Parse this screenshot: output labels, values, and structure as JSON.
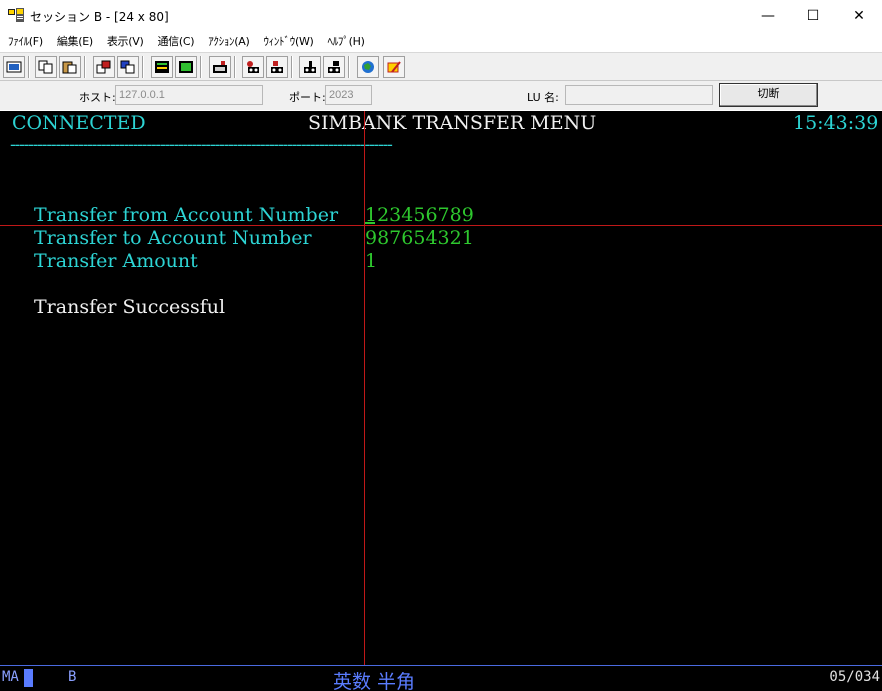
{
  "window": {
    "title": "セッション B - [24 x 80]",
    "controls": {
      "minimize": "—",
      "maximize": "☐",
      "close": "✕"
    }
  },
  "menu": [
    {
      "label": "ﾌｧｲﾙ(F)"
    },
    {
      "label": "編集(E)"
    },
    {
      "label": "表示(V)"
    },
    {
      "label": "通信(C)"
    },
    {
      "label": "ｱｸｼｮﾝ(A)"
    },
    {
      "label": "ｳｨﾝﾄﾞｳ(W)"
    },
    {
      "label": "ﾍﾙﾌﾟ(H)"
    }
  ],
  "toolbar": {
    "icons": [
      "print-screen-icon",
      "copy-icon",
      "paste-icon",
      "send-file-icon",
      "receive-file-icon",
      "display-setup-icon",
      "keyboard-setup-icon",
      "macro-record-icon",
      "macro-play-icon",
      "macro-stop-icon",
      "clipboard-icon",
      "screen-capture-icon",
      "globe-icon",
      "edit-icon"
    ]
  },
  "connection": {
    "host_label": "ホスト:",
    "host_value": "127.0.0.1",
    "port_label": "ポート:",
    "port_value": "2023",
    "lu_label": "LU 名:",
    "lu_value": "",
    "disconnect_label": "切断"
  },
  "terminal": {
    "status": "CONNECTED",
    "screen_title": "SIMBANK TRANSFER MENU",
    "time": "15:43:39",
    "separator": "------------------------------------------------------------------------------------",
    "fields": [
      {
        "label": "Transfer from Account Number",
        "value": "123456789"
      },
      {
        "label": "Transfer to Account Number",
        "value": "987654321"
      },
      {
        "label": "Transfer Amount",
        "value": "1"
      }
    ],
    "message": "Transfer Successful"
  },
  "statusbar": {
    "mode": "MA",
    "session": "B",
    "ime": "英数 半角",
    "cursor_position": "05/034"
  },
  "colors": {
    "terminal_bg": "#000000",
    "cyan_text": "#2dd4d4",
    "green_text": "#2ec82e",
    "white_text": "#f0f0f0",
    "crosshair": "#c01818",
    "status_blue": "#5a7cff"
  }
}
